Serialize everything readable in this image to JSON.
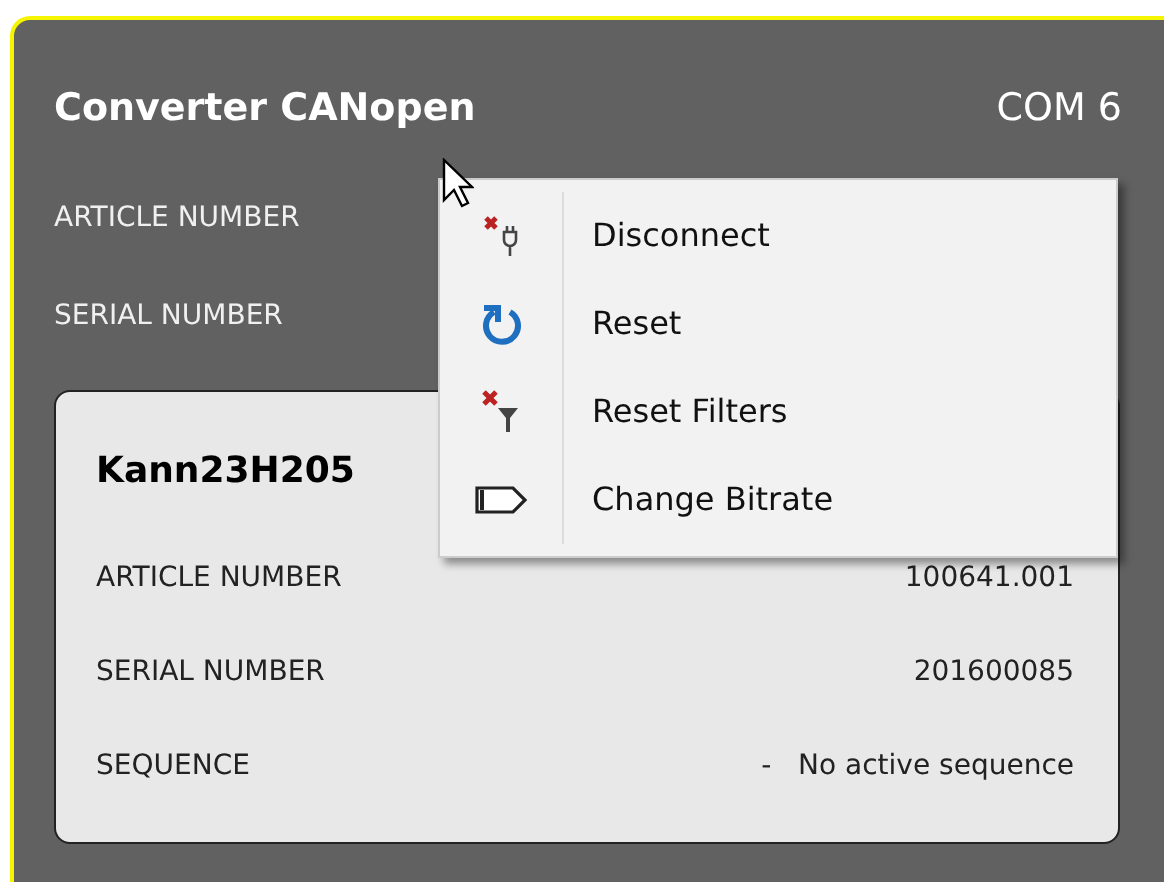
{
  "device": {
    "title": "Converter CANopen",
    "port": "COM 6",
    "fields": [
      {
        "label": "ARTICLE NUMBER"
      },
      {
        "label": "SERIAL NUMBER"
      }
    ]
  },
  "card": {
    "title": "Kann23H205",
    "fields": [
      {
        "label": "ARTICLE NUMBER",
        "value": "100641.001"
      },
      {
        "label": "SERIAL NUMBER",
        "value": "201600085"
      },
      {
        "label": "SEQUENCE",
        "value": "-   No active sequence"
      }
    ]
  },
  "context_menu": {
    "items": [
      {
        "kind": "unplug",
        "label": "Disconnect"
      },
      {
        "kind": "refresh",
        "label": "Reset"
      },
      {
        "kind": "clearfilter",
        "label": "Reset Filters"
      },
      {
        "kind": "tag",
        "label": "Change Bitrate"
      }
    ]
  }
}
